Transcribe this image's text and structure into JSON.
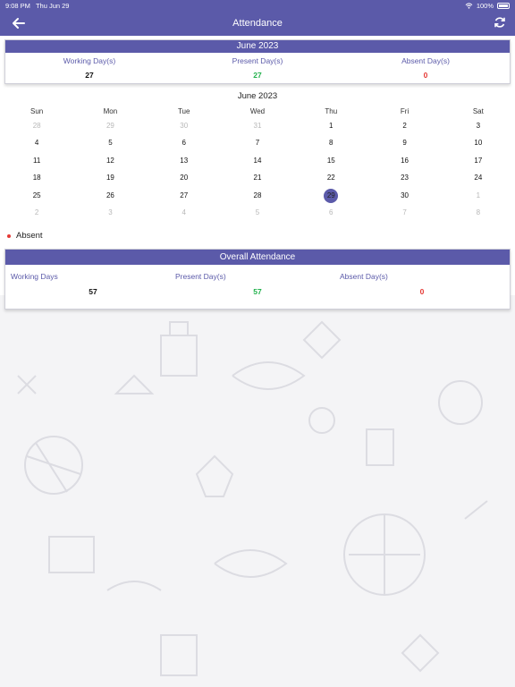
{
  "status_bar": {
    "time": "9:08 PM",
    "date": "Thu Jun 29",
    "battery": "100%"
  },
  "app_bar": {
    "title": "Attendance"
  },
  "month_summary": {
    "title": "June 2023",
    "working_label": "Working Day(s)",
    "working_value": "27",
    "present_label": "Present Day(s)",
    "present_value": "27",
    "absent_label": "Absent Day(s)",
    "absent_value": "0"
  },
  "calendar": {
    "title": "June 2023",
    "weekdays": [
      "Sun",
      "Mon",
      "Tue",
      "Wed",
      "Thu",
      "Fri",
      "Sat"
    ],
    "weeks": [
      [
        {
          "d": "28",
          "m": true
        },
        {
          "d": "29",
          "m": true
        },
        {
          "d": "30",
          "m": true
        },
        {
          "d": "31",
          "m": true
        },
        {
          "d": "1"
        },
        {
          "d": "2"
        },
        {
          "d": "3"
        }
      ],
      [
        {
          "d": "4"
        },
        {
          "d": "5"
        },
        {
          "d": "6"
        },
        {
          "d": "7"
        },
        {
          "d": "8"
        },
        {
          "d": "9"
        },
        {
          "d": "10"
        }
      ],
      [
        {
          "d": "11"
        },
        {
          "d": "12"
        },
        {
          "d": "13"
        },
        {
          "d": "14"
        },
        {
          "d": "15"
        },
        {
          "d": "16"
        },
        {
          "d": "17"
        }
      ],
      [
        {
          "d": "18"
        },
        {
          "d": "19"
        },
        {
          "d": "20"
        },
        {
          "d": "21"
        },
        {
          "d": "22"
        },
        {
          "d": "23"
        },
        {
          "d": "24"
        }
      ],
      [
        {
          "d": "25"
        },
        {
          "d": "26"
        },
        {
          "d": "27"
        },
        {
          "d": "28"
        },
        {
          "d": "29",
          "today": true
        },
        {
          "d": "30"
        },
        {
          "d": "1",
          "m": true
        }
      ],
      [
        {
          "d": "2",
          "m": true
        },
        {
          "d": "3",
          "m": true
        },
        {
          "d": "4",
          "m": true
        },
        {
          "d": "5",
          "m": true
        },
        {
          "d": "6",
          "m": true
        },
        {
          "d": "7",
          "m": true
        },
        {
          "d": "8",
          "m": true
        }
      ]
    ]
  },
  "legend": {
    "absent_label": "Absent"
  },
  "overall": {
    "title": "Overall Attendance",
    "working_label": "Working Days",
    "working_value": "57",
    "present_label": "Present Day(s)",
    "present_value": "57",
    "absent_label": "Absent Day(s)",
    "absent_value": "0"
  },
  "colors": {
    "primary": "#5b5aa9",
    "present": "#22b14c",
    "absent": "#e53935"
  },
  "icons": {
    "back": "arrow-left-icon",
    "refresh": "refresh-icon",
    "wifi": "wifi-icon",
    "battery": "battery-icon"
  }
}
